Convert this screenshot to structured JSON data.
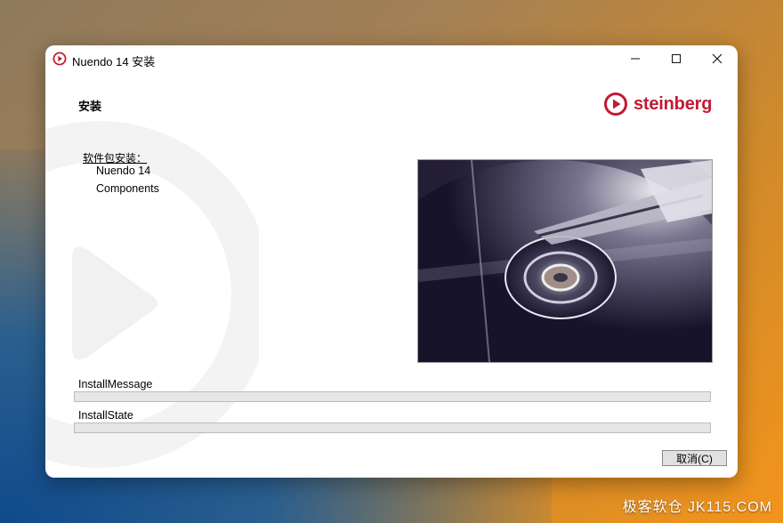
{
  "window": {
    "title": "Nuendo 14 安装"
  },
  "page": {
    "heading": "安装"
  },
  "brand": {
    "name": "steinberg",
    "color": "#c21b33"
  },
  "packages": {
    "label": "软件包安装：",
    "items": [
      "Nuendo 14",
      "Components"
    ]
  },
  "status": {
    "message_label": "InstallMessage",
    "message_progress": 0,
    "state_label": "InstallState",
    "state_progress": 0
  },
  "buttons": {
    "cancel": "取消(C)"
  },
  "watermark_site": "极客软仓 JK115.COM"
}
